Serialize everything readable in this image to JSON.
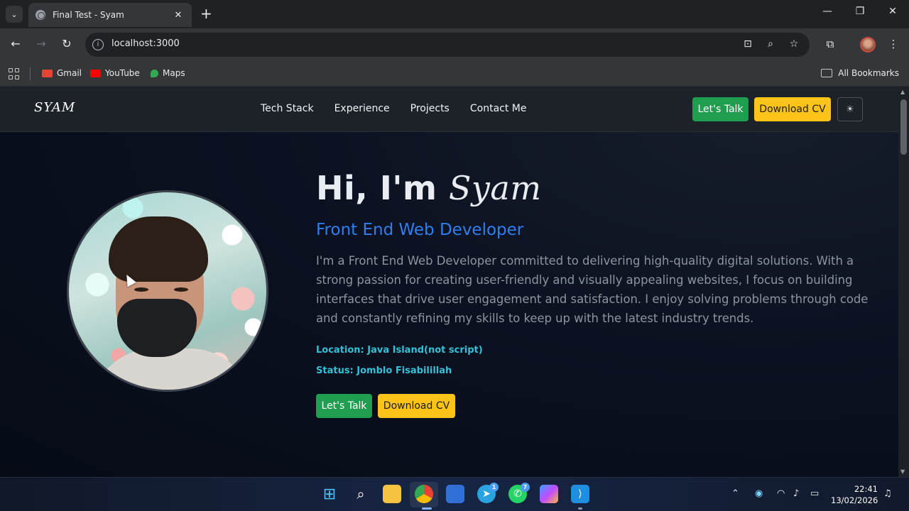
{
  "browser": {
    "tab_title": "Final Test - Syam",
    "tab_close": "✕",
    "new_tab": "+",
    "url": "localhost:3000",
    "bookmarks": [
      {
        "label": "Gmail",
        "icon": "gmail-icon",
        "color": "#ea4335"
      },
      {
        "label": "YouTube",
        "icon": "youtube-icon",
        "color": "#ff0000"
      },
      {
        "label": "Maps",
        "icon": "maps-icon",
        "color": "#34a853"
      }
    ],
    "all_bookmarks": "All Bookmarks"
  },
  "site": {
    "logo": "SYAM",
    "nav": [
      "Tech Stack",
      "Experience",
      "Projects",
      "Contact Me"
    ],
    "lets_talk": "Let's Talk",
    "download_cv": "Download CV",
    "theme_icon": "☀"
  },
  "hero": {
    "greeting": "Hi, I'm",
    "name": "Syam",
    "role": "Front End Web Developer",
    "description": "I'm a Front End Web Developer committed to delivering high-quality digital solutions. With a strong passion for creating user-friendly and visually appealing websites, I focus on building interfaces that drive user engagement and satisfaction. I enjoy solving problems through code and constantly refining my skills to keep up with the latest industry trends.",
    "location": "Location: Java Island(not script)",
    "status": "Status: Jomblo Fisabilillah",
    "lets_talk": "Let's Talk",
    "download_cv": "Download CV"
  },
  "taskbar": {
    "telegram_badge": "1",
    "whatsapp_badge": "7",
    "time": "22:41",
    "date": "13/02/2026"
  },
  "colors": {
    "accent_blue": "#2f7ef2",
    "accent_cyan": "#34c0d6",
    "button_green": "#1f9e50",
    "button_yellow": "#fcc419",
    "page_bg": "#0b1120"
  }
}
